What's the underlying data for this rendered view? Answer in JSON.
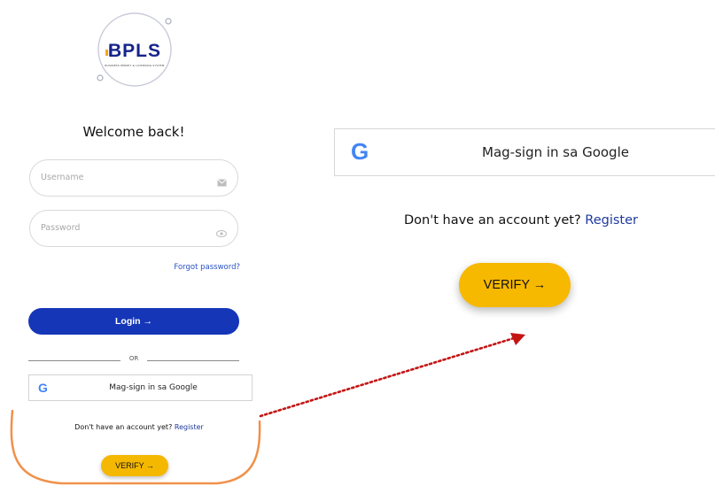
{
  "logo": {
    "text": "BPLS",
    "subtitle": "BUSINESS PERMIT & LICENSING SYSTEM"
  },
  "login": {
    "welcome": "Welcome back!",
    "username_placeholder": "Username",
    "password_placeholder": "Password",
    "forgot_password": "Forgot password?",
    "login_button": "Login →",
    "or_divider": "OR",
    "google_button": "Mag-sign in sa Google",
    "no_account": "Don't have an account yet?",
    "register_link": "Register",
    "verify_button": "VERIFY →"
  },
  "zoom": {
    "google_button": "Mag-sign in sa Google",
    "no_account": "Don't have an account yet?",
    "register_link": "Register",
    "verify_button": "VERIFY →"
  },
  "icons": {
    "google": "G",
    "username_field": "mail-icon",
    "password_field": "eye-icon"
  },
  "colors": {
    "primary": "#1636b8",
    "accent": "#f5b800",
    "highlight": "#f0914a",
    "arrow": "#c41515",
    "link": "#1e3a9c"
  }
}
